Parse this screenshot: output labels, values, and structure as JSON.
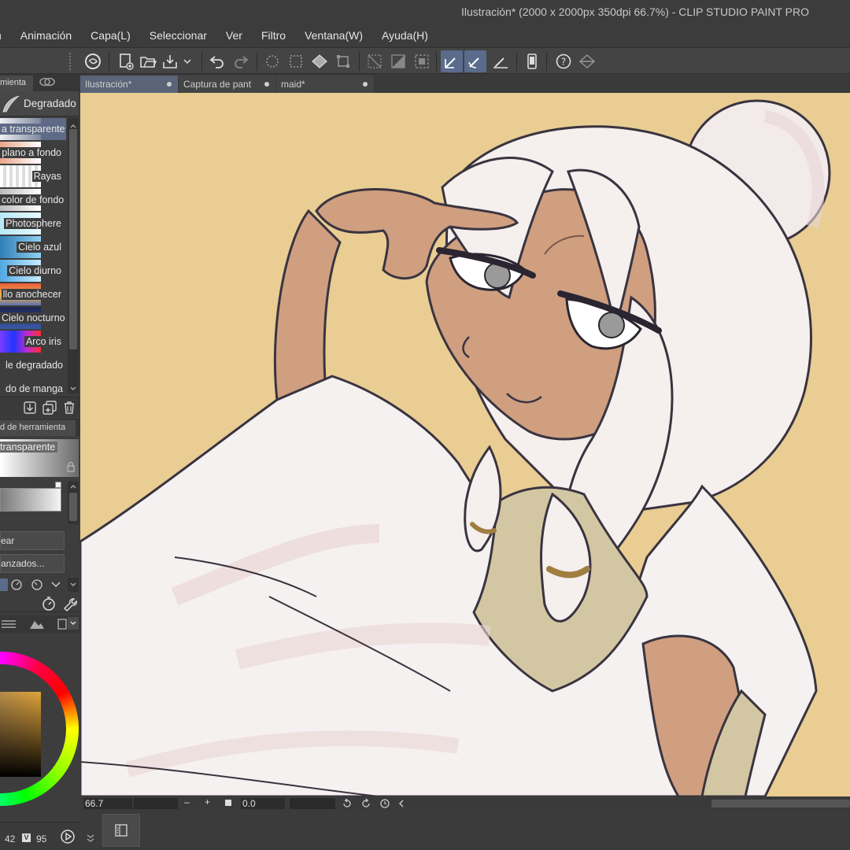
{
  "window": {
    "title": "Ilustración* (2000 x 2000px 350dpi 66.7%)  - CLIP STUDIO PAINT PRO"
  },
  "menu": {
    "items": [
      "n",
      "Animación",
      "Capa(L)",
      "Seleccionar",
      "Ver",
      "Filtro",
      "Ventana(W)",
      "Ayuda(H)"
    ]
  },
  "doc_tabs": [
    {
      "label": "Ilustración*"
    },
    {
      "label": "Captura de pant"
    },
    {
      "label": "maid*"
    }
  ],
  "left_panel": {
    "tab_label": "mienta",
    "gradient_set": "Degradado",
    "gradients": [
      {
        "label": "a transparente"
      },
      {
        "label": "plano a fondo"
      },
      {
        "label": "Rayas"
      },
      {
        "label": "color de fondo"
      },
      {
        "label": "Photosphere"
      },
      {
        "label": "Cielo azul"
      },
      {
        "label": "Cielo diurno"
      },
      {
        "label": "llo anochecer"
      },
      {
        "label": "Cielo nocturno"
      },
      {
        "label": "Arco iris"
      },
      {
        "label": "le degradado"
      },
      {
        "label": "do de manga"
      }
    ],
    "tool_property_tab": "d de herramienta",
    "tool_property_value": "transparente",
    "create_button": "ear",
    "advanced_button": "anzados...",
    "brush_size": "42",
    "opacity_icon": "V",
    "opacity": "95"
  },
  "status": {
    "zoom": "66.7",
    "rotation": "0.0"
  },
  "colors": {
    "canvas_bg": "#e9cd93",
    "active_tab": "#5a6478",
    "active_tool": "#5a6b8c"
  }
}
